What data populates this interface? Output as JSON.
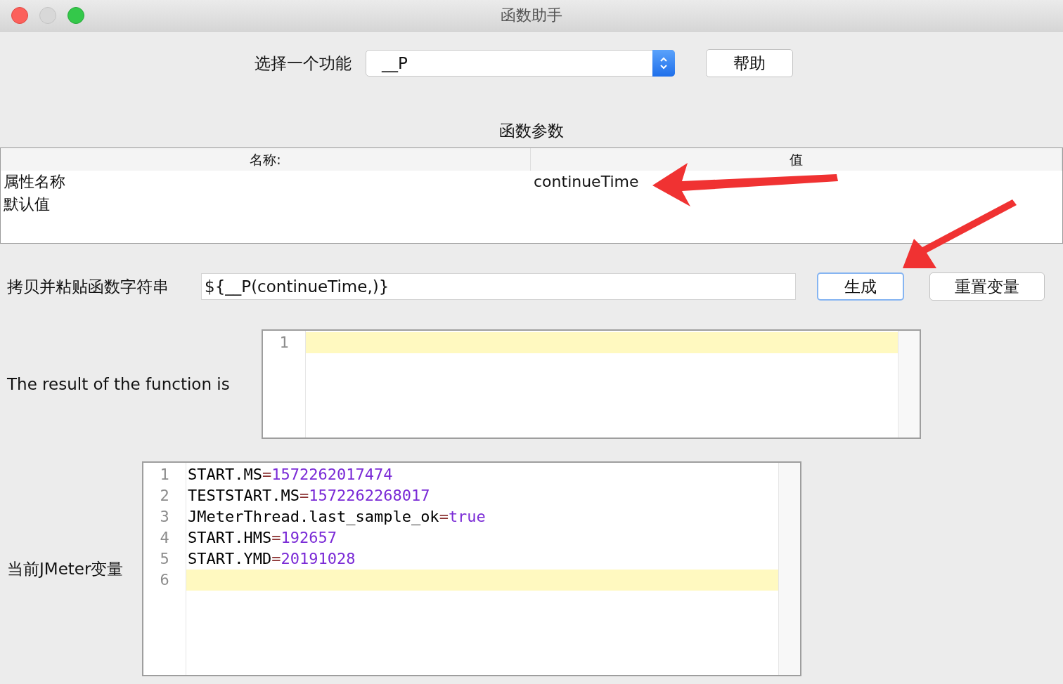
{
  "window": {
    "title": "函数助手"
  },
  "function_select": {
    "label": "选择一个功能",
    "value": "__P"
  },
  "help_button": "帮助",
  "parameters": {
    "title": "函数参数",
    "columns": [
      "名称:",
      "值"
    ],
    "rows": [
      {
        "name": "属性名称",
        "value": "continueTime"
      },
      {
        "name": "默认值"
      }
    ]
  },
  "function_string": {
    "label": "拷贝并粘贴函数字符串",
    "value": "${__P(continueTime,)}"
  },
  "generate_button": {
    "label": "生成",
    "focused": true
  },
  "reset_button": {
    "label": "重置变量",
    "focused": false
  },
  "result": {
    "label": "The result of the function is",
    "lines": [
      {
        "line": "1",
        "current": true
      }
    ]
  },
  "variables": {
    "label": "当前JMeter变量",
    "lines": [
      {
        "line": "1",
        "key": "START.MS",
        "sep": "=",
        "value": "1572262017474",
        "current": false
      },
      {
        "line": "2",
        "key": "TESTSTART.MS",
        "sep": "=",
        "value": "1572262268017",
        "current": false
      },
      {
        "line": "3",
        "key": "JMeterThread.last_sample_ok",
        "sep": "=",
        "value": "true",
        "current": false
      },
      {
        "line": "4",
        "key": "START.HMS",
        "sep": "=",
        "value": "192657",
        "current": false
      },
      {
        "line": "5",
        "key": "START.YMD",
        "sep": "=",
        "value": "20191028",
        "current": false
      },
      {
        "line": "6",
        "current": true
      }
    ]
  }
}
